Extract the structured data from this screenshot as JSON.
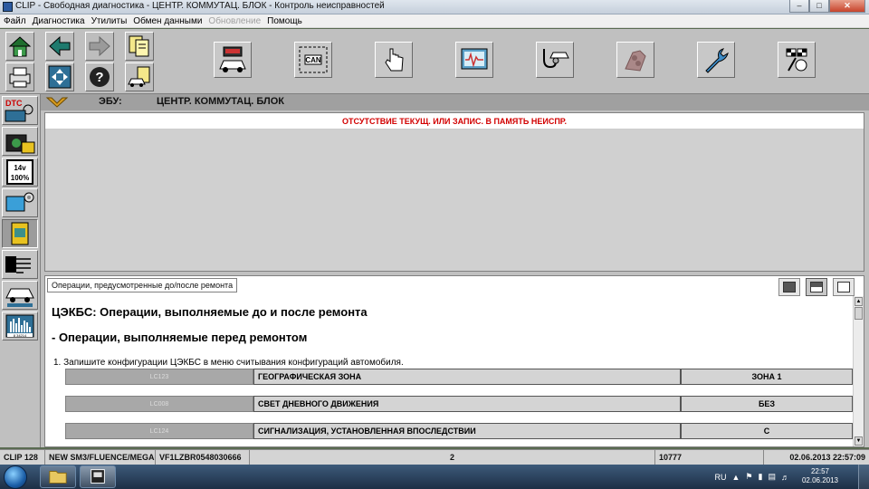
{
  "window": {
    "title": "CLIP - Свободная диагностика - ЦЕНТР. КОММУТАЦ. БЛОК - Контроль неисправностей"
  },
  "menu": [
    {
      "label": "Файл",
      "enabled": true
    },
    {
      "label": "Диагностика",
      "enabled": true
    },
    {
      "label": "Утилиты",
      "enabled": true
    },
    {
      "label": "Обмен данными",
      "enabled": true
    },
    {
      "label": "Обновление",
      "enabled": false
    },
    {
      "label": "Помощь",
      "enabled": true
    }
  ],
  "toolbar": {
    "can_label": "CAN"
  },
  "sidebar": {
    "dtc_label": "DTC",
    "battery_label": "14v",
    "battery_pct": "100%",
    "counter_label": "8 34214"
  },
  "ecu": {
    "label": "ЭБУ:",
    "name": "ЦЕНТР. КОММУТАЦ. БЛОК"
  },
  "faults": {
    "message": "ОТСУТСТВИЕ ТЕКУЩ. ИЛИ ЗАПИС. В ПАМЯТЬ НЕИСПР."
  },
  "operations": {
    "tab_label": "Операции, предусмотренные до/после ремонта",
    "heading": "ЦЭКБС: Операции, выполняемые до и после ремонта",
    "subheading": "- Операции, выполняемые перед ремонтом",
    "step1": "1. Запишите конфигурации ЦЭКБС в меню считывания конфигураций автомобиля.",
    "rows": [
      {
        "code": "LC123",
        "name": "ГЕОГРАФИЧЕСКАЯ ЗОНА",
        "value": "ЗОНА 1"
      },
      {
        "code": "LC008",
        "name": "СВЕТ ДНЕВНОГО ДВИЖЕНИЯ",
        "value": "БЕЗ"
      },
      {
        "code": "LC124",
        "name": "СИГНАЛИЗАЦИЯ, УСТАНОВЛЕННАЯ ВПОСЛЕДСТВИИ",
        "value": "С"
      }
    ]
  },
  "status": {
    "clip": "CLIP 128",
    "vehicle": "NEW SM3/FLUENCE/MEGA",
    "vin": "VF1LZBR0548030666",
    "center": "2",
    "code": "10777",
    "datetime": "02.06.2013 22:57:09"
  },
  "taskbar": {
    "lang": "RU",
    "time": "22:57",
    "date": "02.06.2013"
  },
  "colors": {
    "fault_text": "#d20000",
    "toolbar_bg": "#c0c0c0"
  }
}
